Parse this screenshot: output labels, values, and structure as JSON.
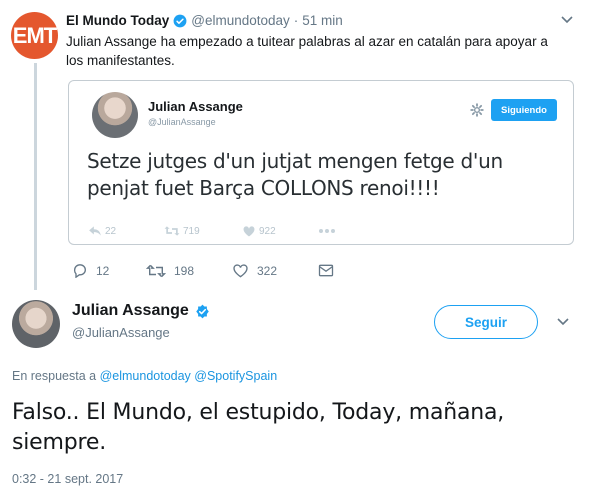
{
  "colors": {
    "accent": "#1da1f2",
    "link": "#1b95e0",
    "muted": "#657786",
    "emt_brand": "#e4572e"
  },
  "tweet1": {
    "avatar_text": "EMT",
    "name": "El Mundo Today",
    "handle": "@elmundotoday",
    "separator": "·",
    "time": "51 min",
    "text": "Julian Assange ha empezado a tuitear palabras al azar en catalán para apoyar a los manifestantes.",
    "embedded": {
      "name": "Julian Assange",
      "handle": "@JulianAssange",
      "follow_label": "Siguiendo",
      "text": "Setze jutges d'un jutjat mengen fetge d'un penjat fuet Barça COLLONS renoi!!!!",
      "replies": "22",
      "retweets": "719",
      "likes": "922"
    },
    "actions": {
      "replies": "12",
      "retweets": "198",
      "likes": "322"
    }
  },
  "tweet2": {
    "name": "Julian Assange",
    "handle": "@JulianAssange",
    "follow_label": "Seguir",
    "reply_prefix": "En respuesta a",
    "reply_user1": "@elmundotoday",
    "reply_user2": "@SpotifySpain",
    "text": "Falso.. El Mundo, el estupido, Today, mañana, siempre.",
    "timestamp": "0:32 - 21 sept. 2017"
  }
}
